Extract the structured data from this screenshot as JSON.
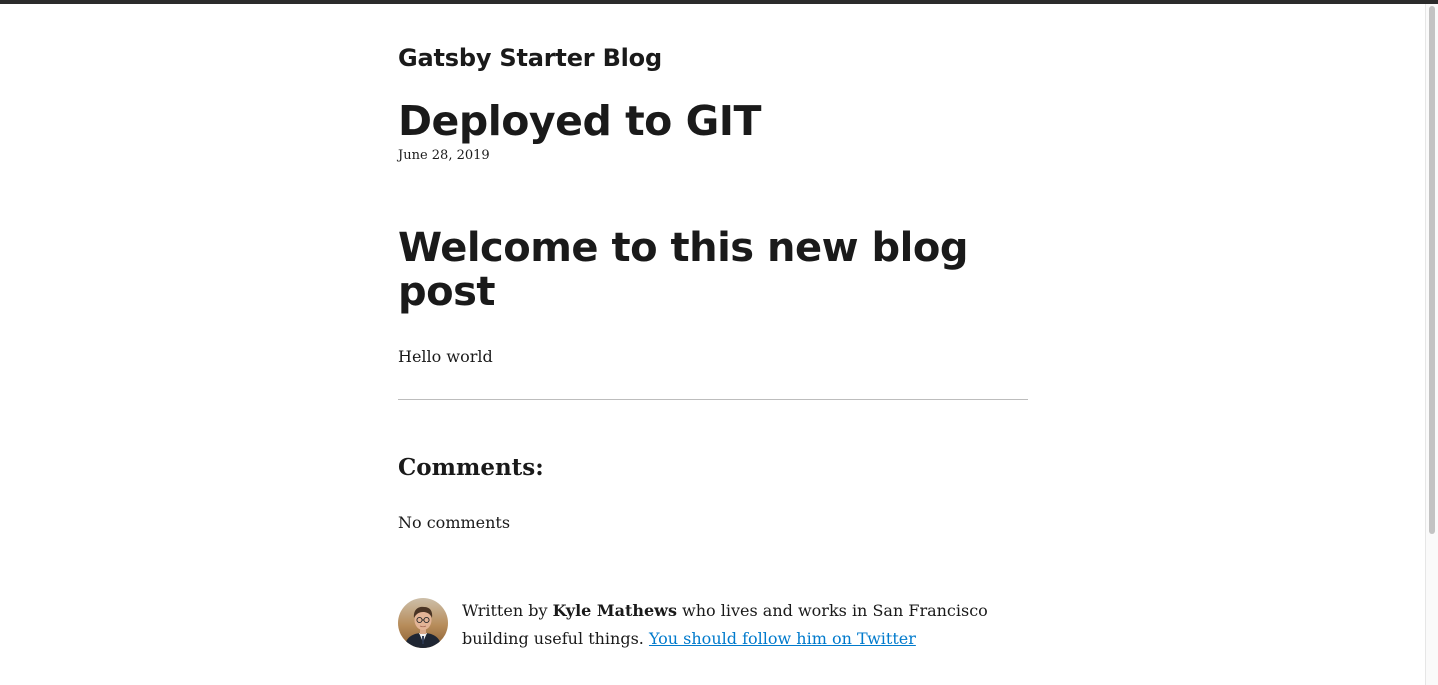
{
  "header": {
    "site_title": "Gatsby Starter Blog"
  },
  "post": {
    "title": "Deployed to GIT",
    "date": "June 28, 2019",
    "heading": "Welcome to this new blog post",
    "body": "Hello world"
  },
  "comments": {
    "heading": "Comments:",
    "empty_text": "No comments"
  },
  "bio": {
    "prefix": "Written by ",
    "author": "Kyle Mathews",
    "suffix": " who lives and works in San Francisco building useful things. ",
    "link_text": "You should follow him on Twitter",
    "avatar_icon": "author-avatar",
    "link_color": "#007acc"
  },
  "colors": {
    "text": "#1a1a1a",
    "top_bar": "#2b2b2b",
    "divider": "#bdbdbd"
  }
}
